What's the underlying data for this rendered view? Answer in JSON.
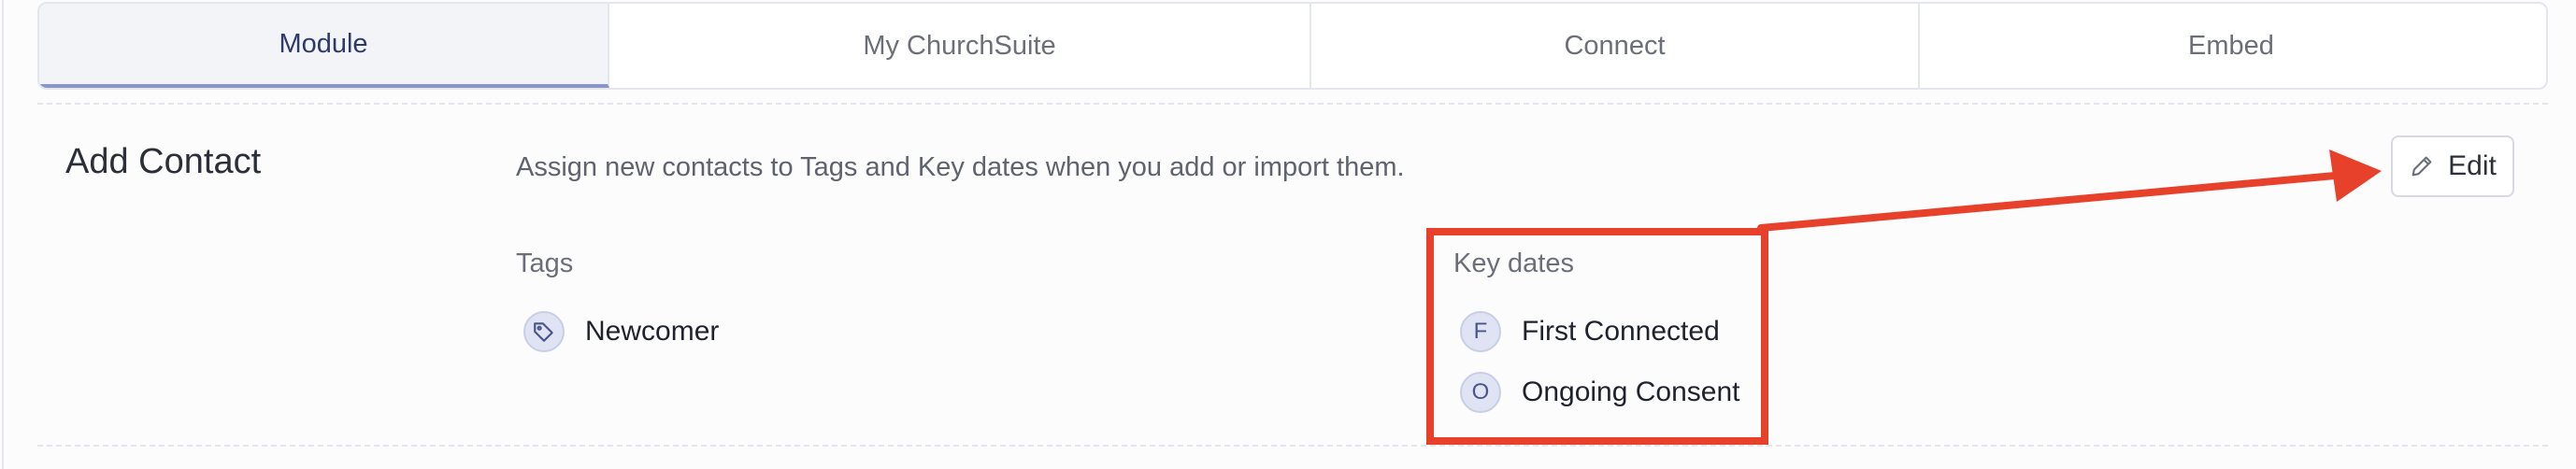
{
  "tabs": [
    {
      "label": "Module",
      "active": true
    },
    {
      "label": "My ChurchSuite",
      "active": false
    },
    {
      "label": "Connect",
      "active": false
    },
    {
      "label": "Embed",
      "active": false
    }
  ],
  "section": {
    "title": "Add Contact",
    "description": "Assign new contacts to Tags and Key dates when you add or import them.",
    "edit_label": "Edit"
  },
  "tags": {
    "label": "Tags",
    "items": [
      {
        "name": "Newcomer",
        "icon": "tag-icon"
      }
    ]
  },
  "key_dates": {
    "label": "Key dates",
    "items": [
      {
        "initial": "F",
        "name": "First Connected"
      },
      {
        "initial": "O",
        "name": "Ongoing Consent"
      }
    ]
  },
  "annotation": {
    "color": "#e8412b",
    "accent": "#8a97c6"
  }
}
